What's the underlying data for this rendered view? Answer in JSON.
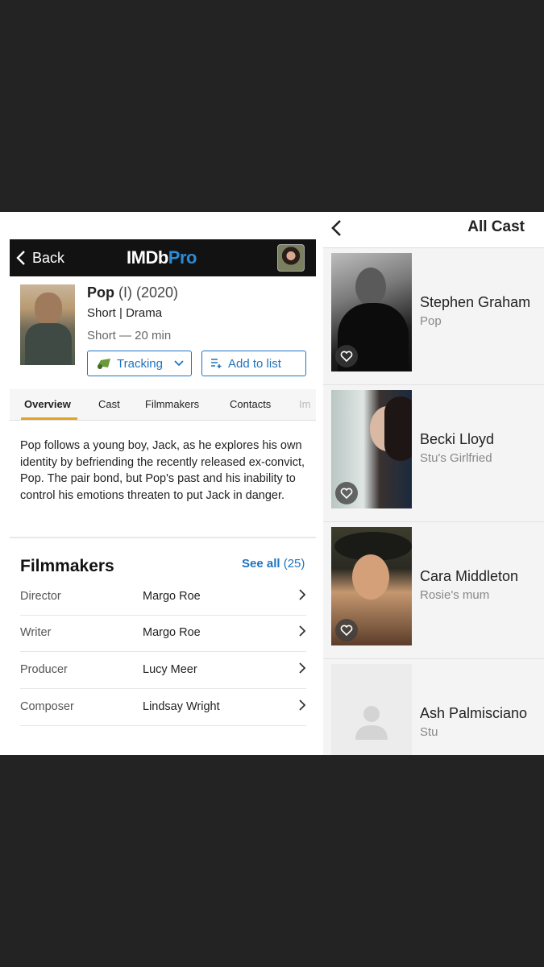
{
  "left": {
    "back_label": "Back",
    "logo_imdb": "IMDb",
    "logo_pro": "Pro",
    "movie": {
      "title": "Pop",
      "title_suffix": "(I) (2020)",
      "genre": "Short | Drama",
      "runtime": "Short — 20 min"
    },
    "buttons": {
      "tracking": "Tracking",
      "add_to_list": "Add to list"
    },
    "tabs": [
      "Overview",
      "Cast",
      "Filmmakers",
      "Contacts",
      "Im"
    ],
    "description": "Pop follows a young boy, Jack, as he explores his own identity by befriending the recently released ex-convict, Pop. The pair bond, but Pop's past and his inability to control his emotions threaten to put Jack in danger.",
    "filmmakers": {
      "heading": "Filmmakers",
      "see_all": "See all",
      "see_all_count": "(25)",
      "rows": [
        {
          "role": "Director",
          "name": "Margo Roe"
        },
        {
          "role": "Writer",
          "name": "Margo Roe"
        },
        {
          "role": "Producer",
          "name": "Lucy Meer"
        },
        {
          "role": "Composer",
          "name": "Lindsay Wright"
        }
      ]
    }
  },
  "right": {
    "title": "All Cast",
    "cast": [
      {
        "name": "Stephen Graham",
        "role": "Pop"
      },
      {
        "name": "Becki Lloyd",
        "role": "Stu's Girlfried"
      },
      {
        "name": "Cara Middleton",
        "role": "Rosie's mum"
      },
      {
        "name": "Ash Palmisciano",
        "role": "Stu"
      }
    ]
  },
  "colors": {
    "accent_blue": "#1f74bf",
    "tab_underline": "#e0a325",
    "topbar": "#121212",
    "page_bg": "#232324"
  }
}
